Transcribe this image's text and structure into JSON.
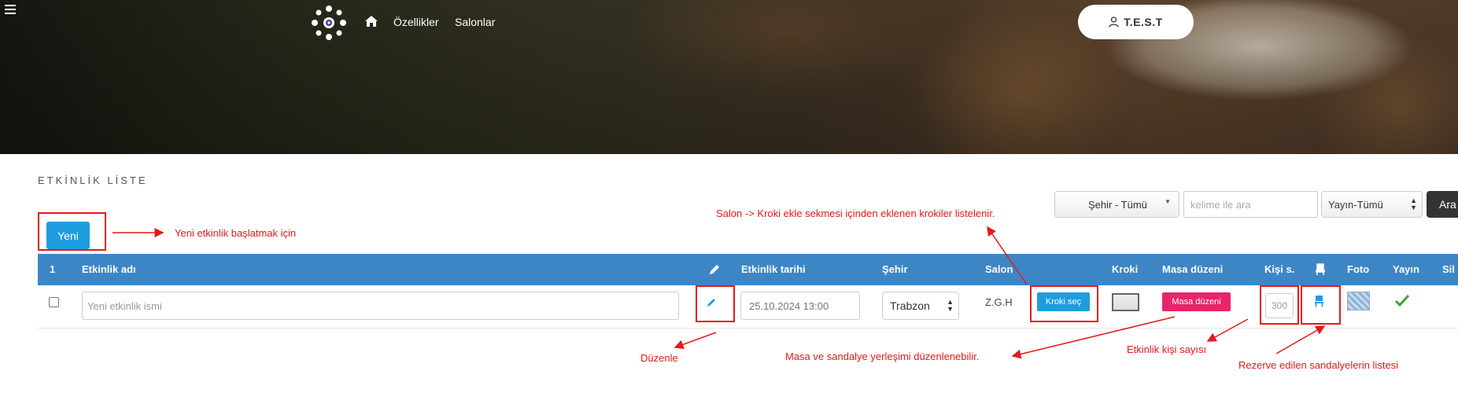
{
  "header": {
    "nav": {
      "features": "Özellikler",
      "salons": "Salonlar"
    },
    "user_label": "T.E.S.T"
  },
  "page": {
    "title": "ETKİNLİK LİSTE",
    "new_button": "Yeni"
  },
  "filters": {
    "city": "Şehir - Tümü",
    "search_placeholder": "kelime ile ara",
    "publish": "Yayın-Tümü",
    "search_button": "Ara"
  },
  "table": {
    "headers": {
      "count": "1",
      "name": "Etkinlik adı",
      "date": "Etkinlik tarihi",
      "city": "Şehir",
      "salon": "Salon",
      "kroki": "Kroki",
      "table_layout": "Masa düzeni",
      "persons": "Kişi s.",
      "photo": "Foto",
      "publish": "Yayın",
      "delete": "Sil"
    },
    "row": {
      "name_placeholder": "Yeni etkinlik ismi",
      "date": "25.10.2024 13:00",
      "city": "Trabzon",
      "salon": "Z.G.H",
      "kroki_button": "Kroki seç",
      "table_button": "Masa düzeni",
      "persons": "300"
    }
  },
  "annotations": {
    "new_event": "Yeni etkinlik başlatmak için",
    "kroki_list": "Salon -> Kroki ekle sekmesi içinden eklenen krokiler listelenir.",
    "edit": "Düzenle",
    "table_layout": "Masa ve sandalye yerleşimi düzenlenebilir.",
    "person_count": "Etkinlik kişi sayısı",
    "reserved_chairs": "Rezerve edilen sandalyelerin listesi"
  },
  "colors": {
    "header_blue": "#3d86c6",
    "button_blue": "#1e9ce0",
    "masa_pink": "#e6256b",
    "annotation_red": "#e21a1a"
  },
  "icons": [
    "menu-icon",
    "logo-icon",
    "home-icon",
    "user-icon",
    "pencil-icon",
    "chair-icon",
    "check-icon",
    "sort-icon"
  ]
}
